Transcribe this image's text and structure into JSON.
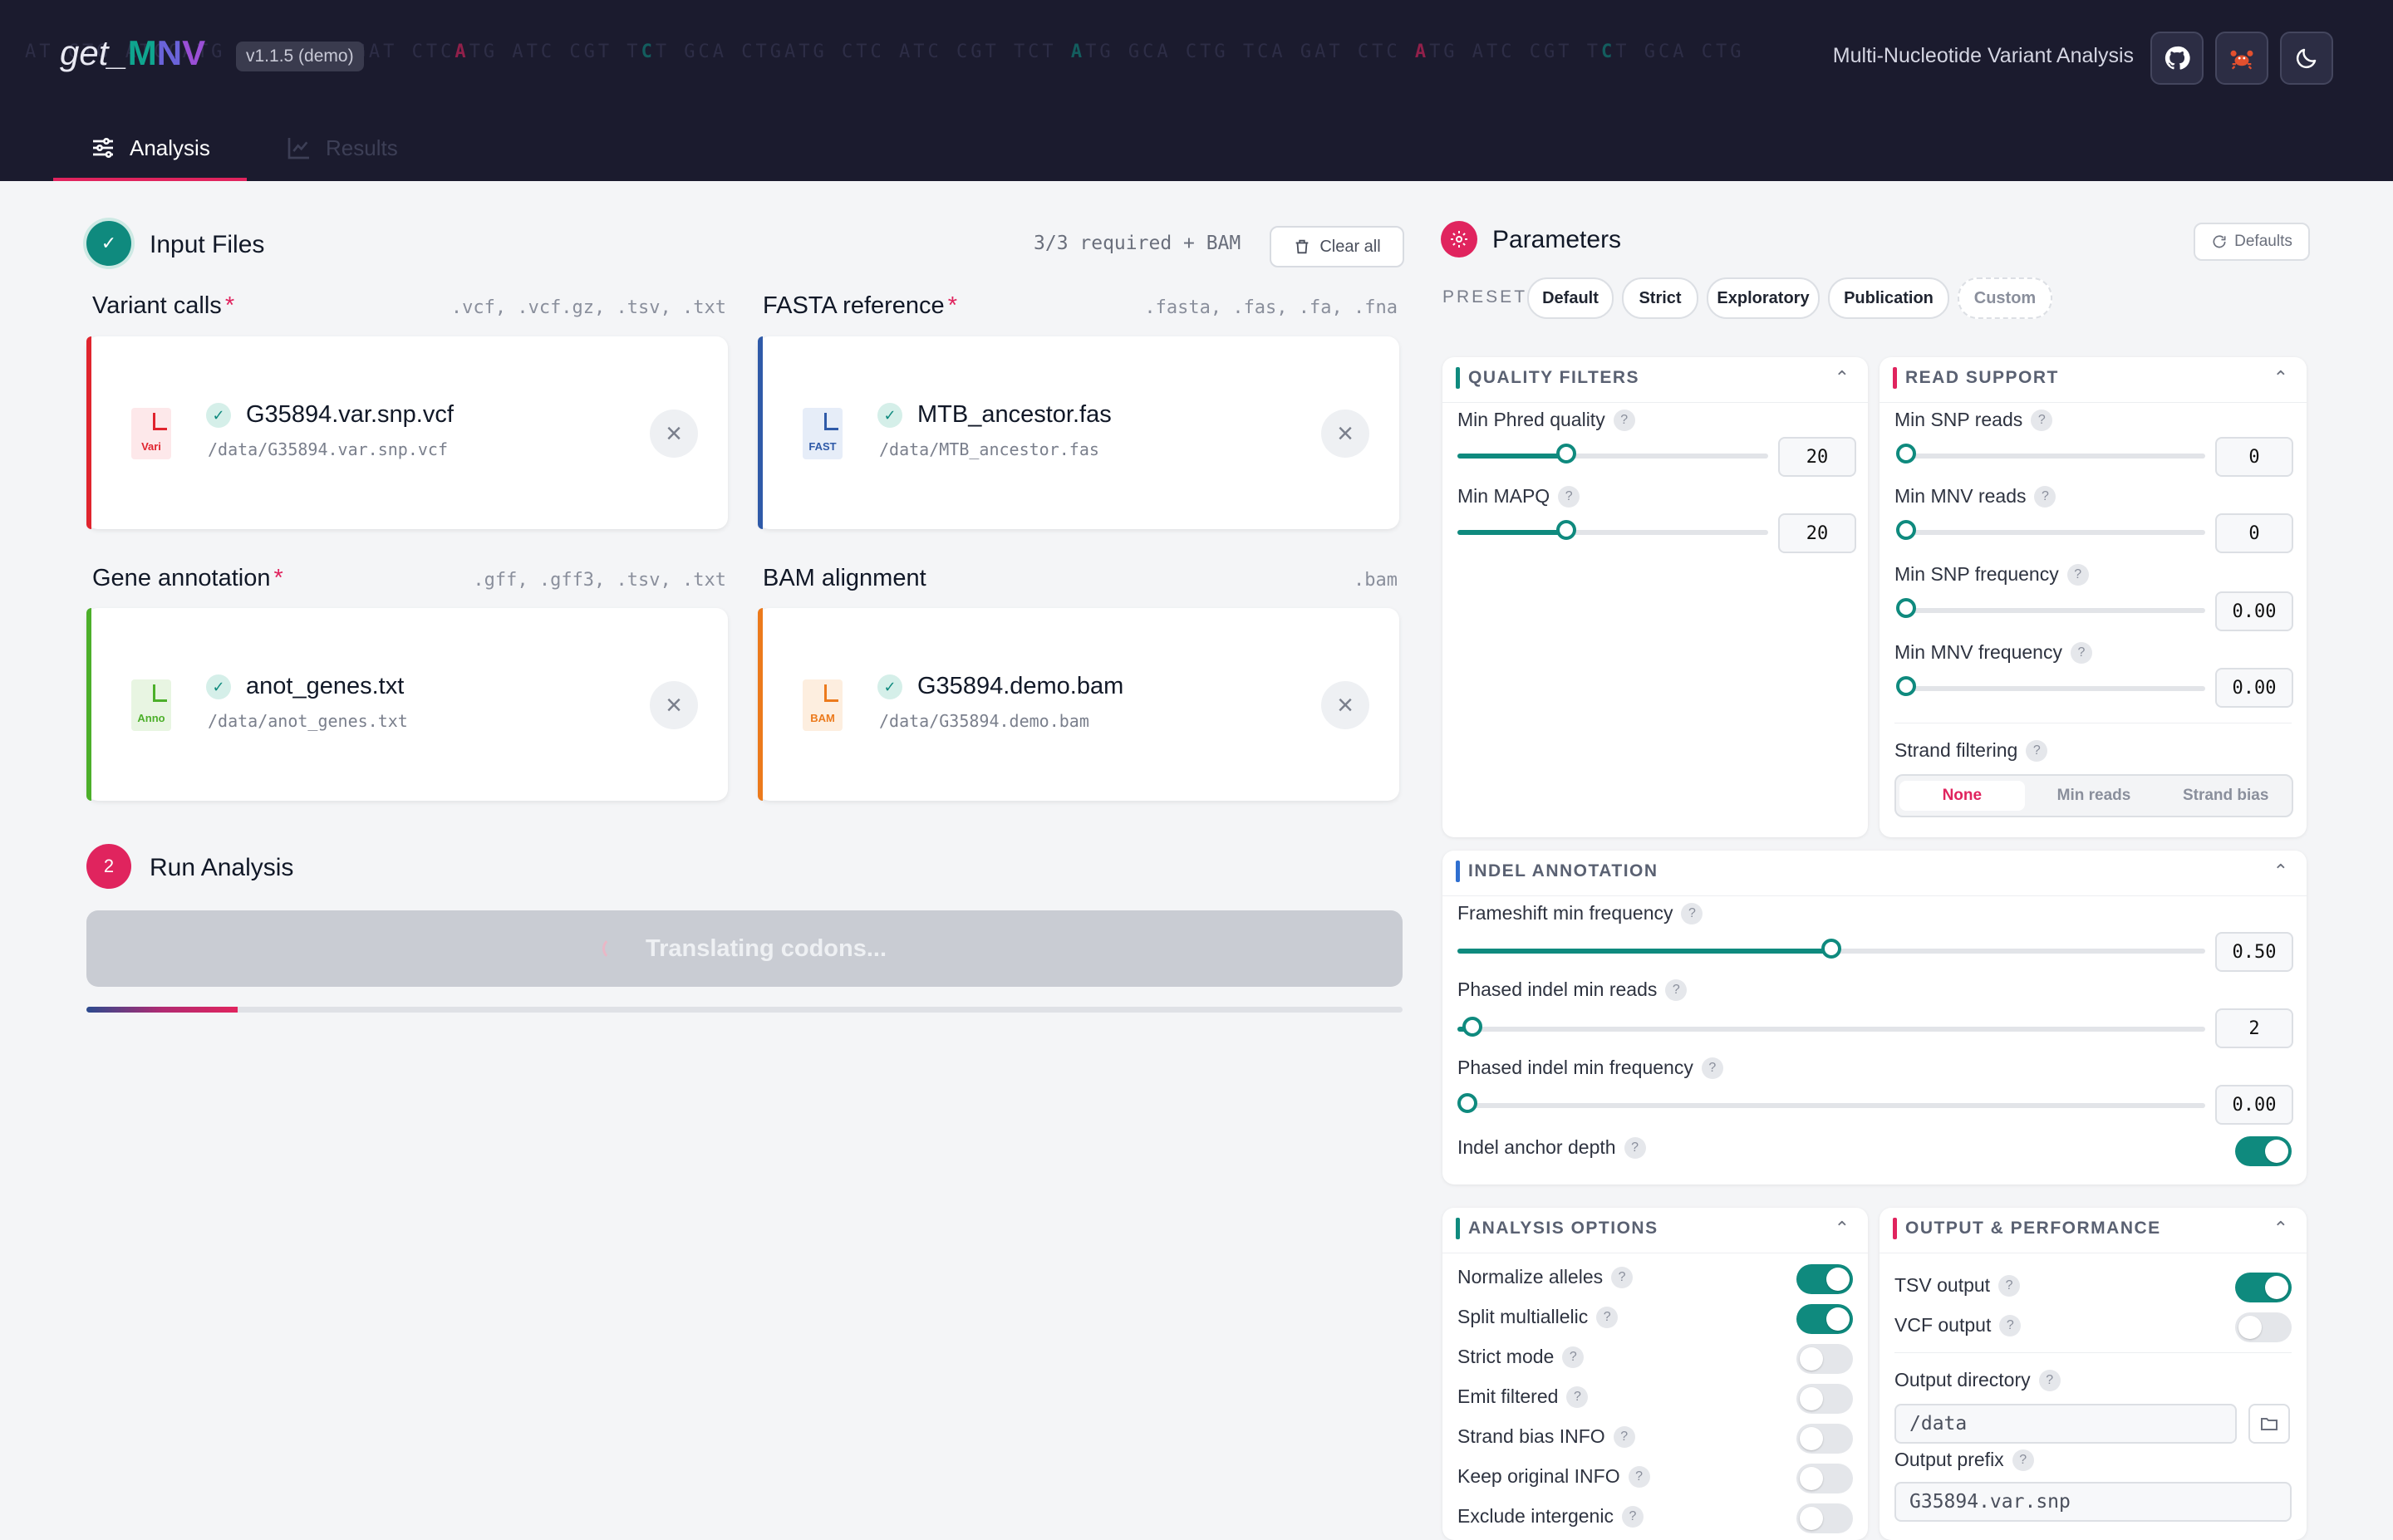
{
  "header": {
    "logo_prefix": "get_",
    "logo_m": "M",
    "logo_n": "N",
    "logo_v": "V",
    "version": "v1.1.5 (demo)",
    "subtitle": "Multi-Nucleotide Variant Analysis",
    "buttons": [
      "github-icon",
      "crab-icon",
      "moon-icon"
    ]
  },
  "nav": {
    "tabs": [
      {
        "label": "Analysis",
        "active": true
      },
      {
        "label": "Results",
        "active": false
      }
    ]
  },
  "input_files": {
    "title": "Input Files",
    "status": "3/3 required + BAM",
    "clear_all": "Clear all",
    "slots": [
      {
        "heading": "Variant calls",
        "required": "*",
        "extensions": ".vcf, .vcf.gz, .tsv, .txt",
        "file_name": "G35894.var.snp.vcf",
        "file_path": "/data/G35894.var.snp.vcf",
        "icon_tag": "Vari",
        "color": "#e0242e"
      },
      {
        "heading": "FASTA reference",
        "required": "*",
        "extensions": ".fasta, .fas, .fa, .fna",
        "file_name": "MTB_ancestor.fas",
        "file_path": "/data/MTB_ancestor.fas",
        "icon_tag": "FAST",
        "color": "#2f5aa8"
      },
      {
        "heading": "Gene annotation",
        "required": "*",
        "extensions": ".gff, .gff3, .tsv, .txt",
        "file_name": "anot_genes.txt",
        "file_path": "/data/anot_genes.txt",
        "icon_tag": "Anno",
        "color": "#4caf2a"
      },
      {
        "heading": "BAM alignment",
        "required": "",
        "extensions": ".bam",
        "file_name": "G35894.demo.bam",
        "file_path": "/data/G35894.demo.bam",
        "icon_tag": "BAM",
        "color": "#ec7a1c"
      }
    ]
  },
  "run": {
    "step": "2",
    "title": "Run Analysis",
    "button_label": "Translating codons...",
    "progress": 0.115
  },
  "parameters": {
    "title": "Parameters",
    "defaults": "Defaults",
    "preset_label": "PRESET",
    "presets": [
      "Default",
      "Strict",
      "Exploratory",
      "Publication",
      "Custom"
    ],
    "quality": {
      "title": "QUALITY FILTERS",
      "min_phred_label": "Min Phred quality",
      "min_phred_value": "20",
      "min_phred_fill": 0.35,
      "min_mapq_label": "Min MAPQ",
      "min_mapq_value": "20",
      "min_mapq_fill": 0.35
    },
    "read_support": {
      "title": "READ SUPPORT",
      "min_snp_reads_label": "Min SNP reads",
      "min_snp_reads_value": "0",
      "min_mnv_reads_label": "Min MNV reads",
      "min_mnv_reads_value": "0",
      "min_snp_freq_label": "Min SNP frequency",
      "min_snp_freq_value": "0.00",
      "min_mnv_freq_label": "Min MNV frequency",
      "min_mnv_freq_value": "0.00",
      "strand_label": "Strand filtering",
      "strand_options": [
        "None",
        "Min reads",
        "Strand bias"
      ],
      "strand_selected": "None"
    },
    "indel": {
      "title": "INDEL ANNOTATION",
      "frameshift_label": "Frameshift min frequency",
      "frameshift_value": "0.50",
      "frameshift_fill": 0.5,
      "phased_reads_label": "Phased indel min reads",
      "phased_reads_value": "2",
      "phased_reads_fill": 0.02,
      "phased_freq_label": "Phased indel min frequency",
      "phased_freq_value": "0.00",
      "anchor_label": "Indel anchor depth",
      "anchor_on": true
    },
    "analysis_options": {
      "title": "ANALYSIS OPTIONS",
      "items": [
        {
          "label": "Normalize alleles",
          "on": true
        },
        {
          "label": "Split multiallelic",
          "on": true
        },
        {
          "label": "Strict mode",
          "on": false
        },
        {
          "label": "Emit filtered",
          "on": false
        },
        {
          "label": "Strand bias INFO",
          "on": false
        },
        {
          "label": "Keep original INFO",
          "on": false
        },
        {
          "label": "Exclude intergenic",
          "on": false
        }
      ]
    },
    "output": {
      "title": "OUTPUT & PERFORMANCE",
      "tsv_label": "TSV output",
      "tsv_on": true,
      "vcf_label": "VCF output",
      "vcf_on": false,
      "dir_label": "Output directory",
      "dir_value": "/data",
      "prefix_label": "Output prefix",
      "prefix_value": "G35894.var.snp"
    }
  },
  "colors": {
    "accent": "#e0245e",
    "teal": "#0f8a7e",
    "header_bg": "#1b1b2e"
  }
}
